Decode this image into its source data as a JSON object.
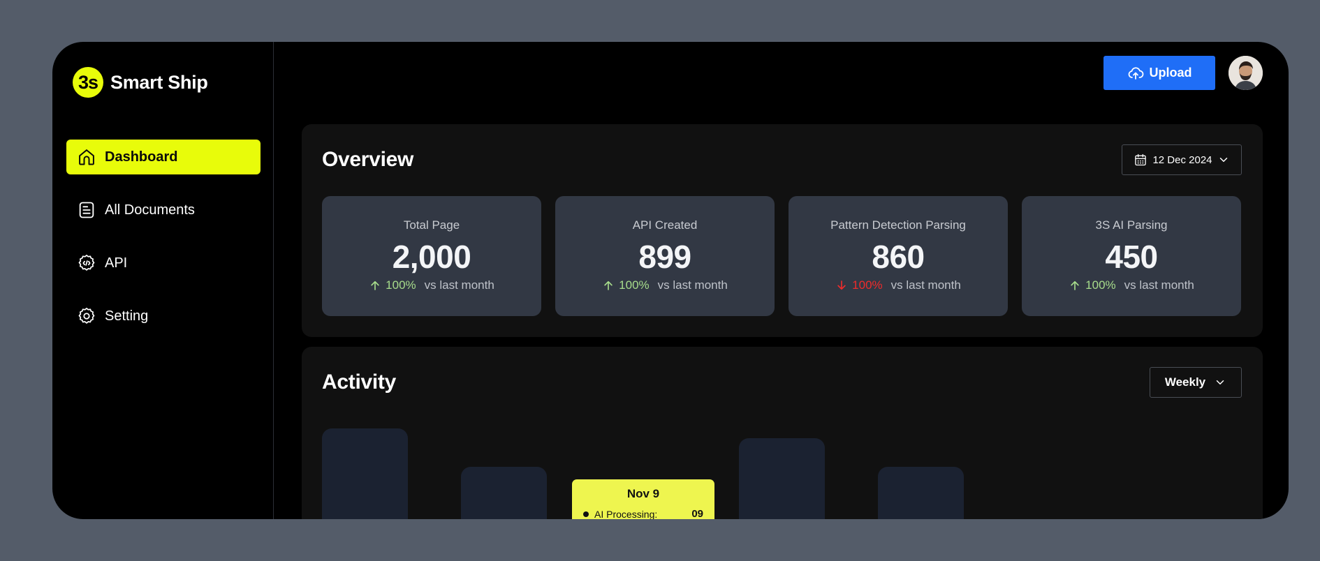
{
  "brand": {
    "mark": "3s",
    "name": "Smart Ship",
    "accent": "#e8fc0a"
  },
  "sidebar": {
    "items": [
      {
        "label": "Dashboard",
        "icon": "home-icon",
        "active": true
      },
      {
        "label": "All Documents",
        "icon": "document-icon",
        "active": false
      },
      {
        "label": "API",
        "icon": "api-gear-icon",
        "active": false
      },
      {
        "label": "Setting",
        "icon": "settings-gear-icon",
        "active": false
      }
    ]
  },
  "header": {
    "upload_label": "Upload",
    "avatar": "user-avatar"
  },
  "overview": {
    "title": "Overview",
    "date_label": "12 Dec 2024",
    "cards": [
      {
        "label": "Total Page",
        "value": "2,000",
        "change": "100%",
        "direction": "up",
        "comparison": "vs last month"
      },
      {
        "label": "API Created",
        "value": "899",
        "change": "100%",
        "direction": "up",
        "comparison": "vs last month"
      },
      {
        "label": "Pattern Detection Parsing",
        "value": "860",
        "change": "100%",
        "direction": "down",
        "comparison": "vs last month"
      },
      {
        "label": "3S AI Parsing",
        "value": "450",
        "change": "100%",
        "direction": "up",
        "comparison": "vs last month"
      }
    ]
  },
  "activity": {
    "title": "Activity",
    "period_label": "Weekly",
    "tooltip": {
      "title": "Nov 9",
      "row_label": "AI Processing:",
      "row_value": "09"
    }
  },
  "colors": {
    "primary": "#1f6ef7",
    "up": "#a7dc8b",
    "down": "#ef2b2b",
    "card": "#323844",
    "bar": "#1b2231",
    "tooltip": "#eef54f"
  }
}
